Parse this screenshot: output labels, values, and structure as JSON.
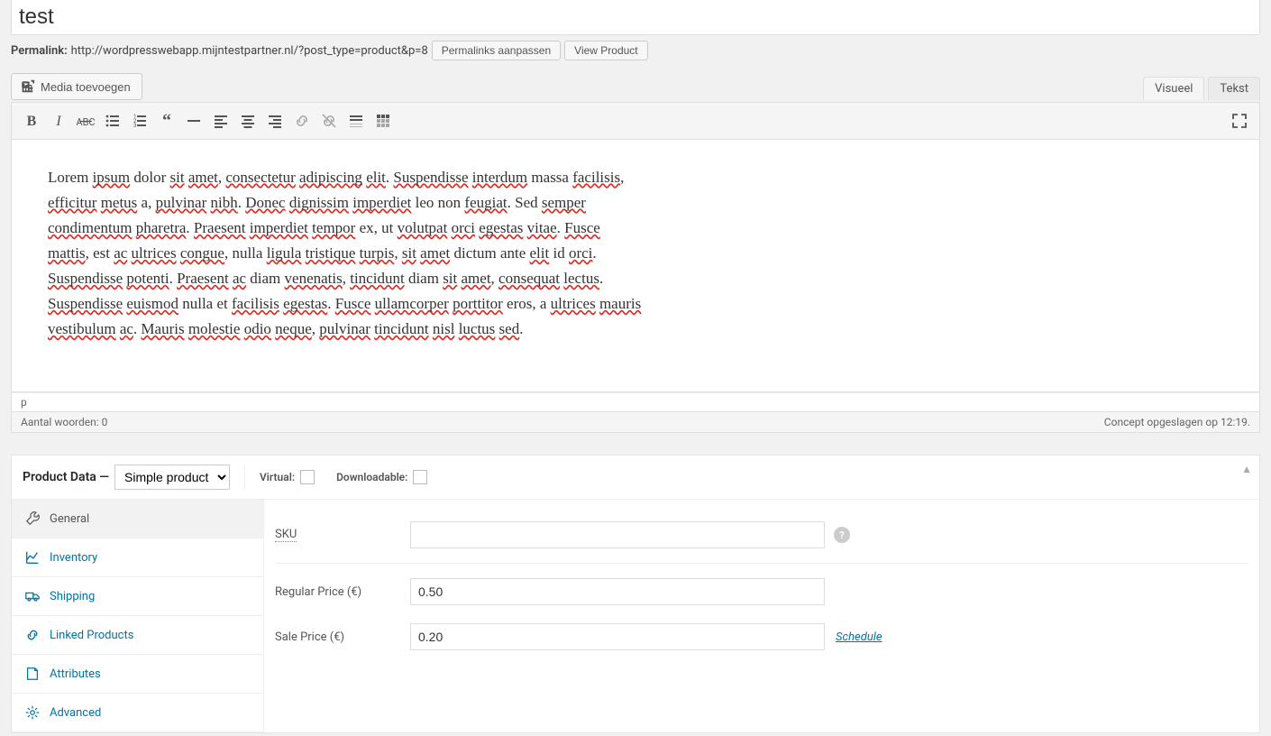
{
  "title": {
    "value": "test"
  },
  "permalink": {
    "label": "Permalink:",
    "url": "http://wordpresswebapp.mijntestpartner.nl/?post_type=product&p=8",
    "edit_btn": "Permalinks aanpassen",
    "view_btn": "View Product"
  },
  "media_btn": "Media toevoegen",
  "editor_tabs": {
    "visual": "Visueel",
    "text": "Tekst"
  },
  "editor_body": "Lorem ipsum dolor sit amet, consectetur adipiscing elit. Suspendisse interdum massa facilisis, efficitur metus a, pulvinar nibh. Donec dignissim imperdiet leo non feugiat. Sed semper condimentum pharetra. Praesent imperdiet tempor ex, ut volutpat orci egestas vitae. Fusce mattis, est ac ultrices congue, nulla ligula tristique turpis, sit amet dictum ante elit id orci. Suspendisse potenti. Praesent ac diam venenatis, tincidunt diam sit amet, consequat lectus. Suspendisse euismod nulla et facilisis egestas. Fusce ullamcorper porttitor eros, a ultrices mauris vestibulum ac. Mauris molestie odio neque, pulvinar tincidunt nisl luctus sed.",
  "editor_spellchecked_words": [
    "ipsum",
    "sit",
    "amet",
    "consectetur",
    "adipiscing",
    "elit",
    "Suspendisse",
    "interdum",
    "facilisis",
    "efficitur",
    "metus",
    "pulvinar",
    "nibh",
    "Donec",
    "dignissim",
    "imperdiet",
    "feugiat",
    "semper",
    "condimentum",
    "pharetra",
    "Praesent",
    "imperdiet",
    "tempor",
    "volutpat",
    "orci",
    "egestas",
    "vitae",
    "Fusce",
    "mattis",
    "ac",
    "ultrices",
    "congue",
    "ligula",
    "tristique",
    "turpis",
    "amet",
    "elit",
    "orci",
    "Suspendisse",
    "potenti",
    "Praesent",
    "venenatis",
    "tincidunt",
    "amet",
    "consequat",
    "lectus",
    "Suspendisse",
    "euismod",
    "facilisis",
    "egestas",
    "Fusce",
    "ullamcorper",
    "porttitor",
    "ultrices",
    "mauris",
    "vestibulum",
    "Mauris",
    "molestie",
    "odio",
    "neque",
    "pulvinar",
    "tincidunt",
    "nisl",
    "luctus",
    "sed"
  ],
  "status_bar": {
    "element_path": "p",
    "word_count": "Aantal woorden: 0",
    "draft_saved": "Concept opgeslagen op 12:19."
  },
  "product_data": {
    "header_label": "Product Data —",
    "type_select": "Simple product",
    "virtual_label": "Virtual:",
    "downloadable_label": "Downloadable:",
    "tabs": {
      "general": "General",
      "inventory": "Inventory",
      "shipping": "Shipping",
      "linked": "Linked Products",
      "attributes": "Attributes",
      "advanced": "Advanced"
    },
    "fields": {
      "sku_label": "SKU",
      "sku_value": "",
      "regular_label": "Regular Price (€)",
      "regular_value": "0.50",
      "sale_label": "Sale Price (€)",
      "sale_value": "0.20",
      "schedule": "Schedule"
    }
  }
}
